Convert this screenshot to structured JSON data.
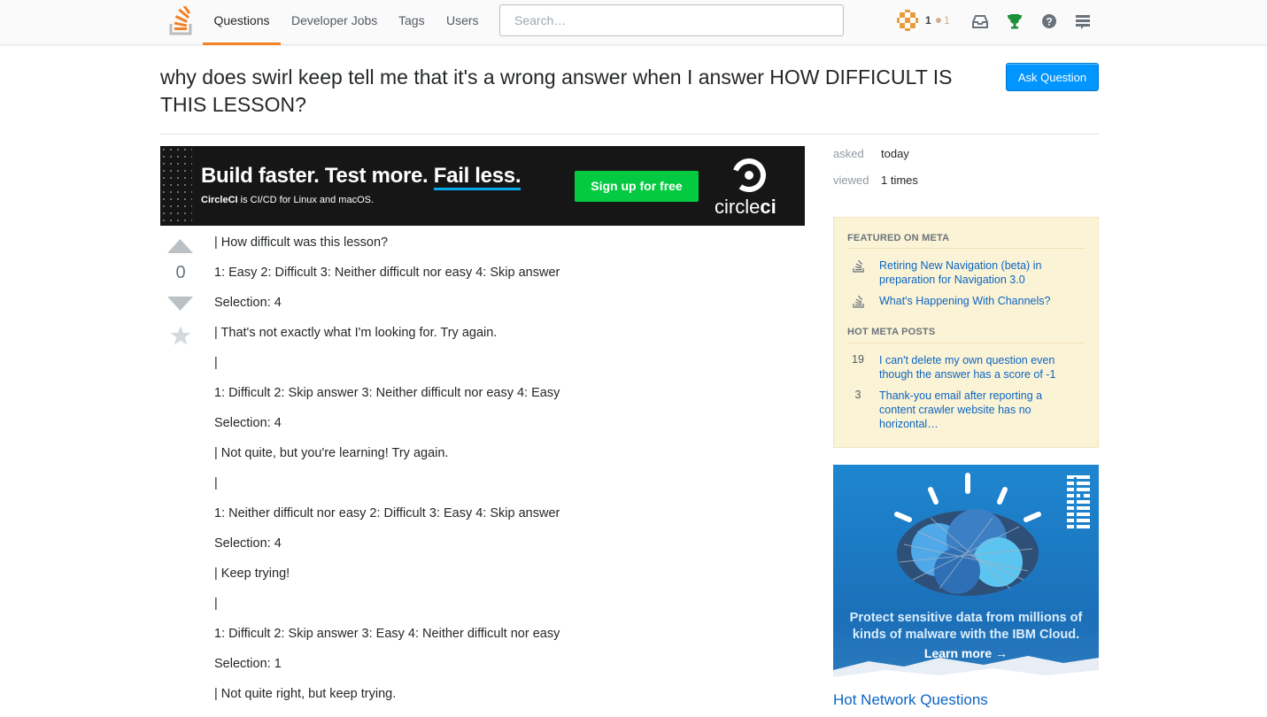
{
  "nav": {
    "questions": "Questions",
    "developer_jobs": "Developer Jobs",
    "tags": "Tags",
    "users": "Users"
  },
  "search": {
    "placeholder": "Search…"
  },
  "user": {
    "reputation": "1",
    "bronze_badges": "1"
  },
  "question": {
    "title": "why does swirl keep tell me that it's a wrong answer when I answer HOW DIFFICULT IS THIS LESSON?",
    "votes": "0",
    "body": [
      "| How difficult was this lesson?",
      "1: Easy 2: Difficult 3: Neither difficult nor easy 4: Skip answer",
      "Selection: 4",
      "| That's not exactly what I'm looking for. Try again.",
      "|",
      "1: Difficult 2: Skip answer 3: Neither difficult nor easy 4: Easy",
      "Selection: 4",
      "| Not quite, but you're learning! Try again.",
      "|",
      "1: Neither difficult nor easy 2: Difficult 3: Easy 4: Skip answer",
      "Selection: 4",
      "| Keep trying!",
      "|",
      "1: Difficult 2: Skip answer 3: Easy 4: Neither difficult nor easy",
      "Selection: 1",
      "| Not quite right, but keep trying."
    ]
  },
  "ask_button": "Ask Question",
  "ad_banner": {
    "headline_a": "Build faster. Test more. ",
    "headline_b": "Fail less.",
    "brand": "CircleCI",
    "sub": " is CI/CD for Linux and macOS.",
    "cta": "Sign up for free",
    "logo_a": "circle",
    "logo_b": "ci"
  },
  "meta": {
    "asked_label": "asked",
    "asked_value": "today",
    "viewed_label": "viewed",
    "viewed_value": "1 times"
  },
  "featured": {
    "heading": "FEATURED ON META",
    "items": [
      "Retiring New Navigation (beta) in preparation for Navigation 3.0",
      "What's Happening With Channels?"
    ],
    "hot_heading": "HOT META POSTS",
    "hot": [
      {
        "count": "19",
        "title": "I can't delete my own question even though the answer has a score of -1"
      },
      {
        "count": "3",
        "title": "Thank-you email after reporting a content crawler website has no horizontal…"
      }
    ]
  },
  "ibm_ad": {
    "text_a": "Protect sensitive data from millions of",
    "text_b": "kinds of malware with the IBM Cloud.",
    "learn": "Learn more →"
  },
  "hot_network": "Hot Network Questions",
  "colors": {
    "accent": "#f48024",
    "link": "#0c65c2",
    "button": "#0095ff",
    "featured_bg": "#fbf3d5"
  }
}
